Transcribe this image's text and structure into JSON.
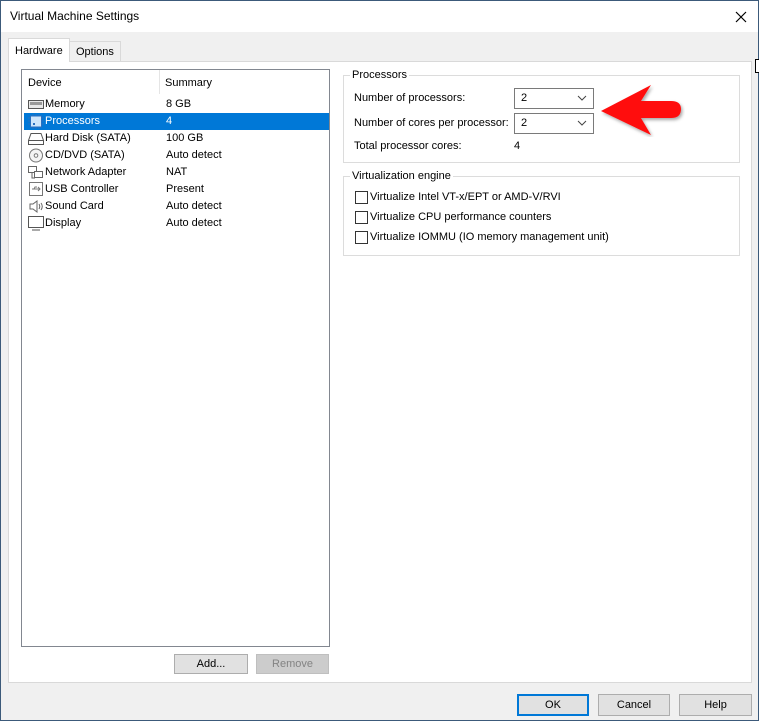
{
  "window": {
    "title": "Virtual Machine Settings",
    "close_icon": "close-icon"
  },
  "tabs": [
    {
      "label": "Hardware",
      "active": true
    },
    {
      "label": "Options",
      "active": false
    }
  ],
  "device_list": {
    "columns": [
      "Device",
      "Summary"
    ],
    "rows": [
      {
        "name": "Memory",
        "summary": "8 GB",
        "icon": "memory-icon",
        "selected": false
      },
      {
        "name": "Processors",
        "summary": "4",
        "icon": "processor-icon",
        "selected": true
      },
      {
        "name": "Hard Disk (SATA)",
        "summary": "100 GB",
        "icon": "hard-disk-icon",
        "selected": false
      },
      {
        "name": "CD/DVD (SATA)",
        "summary": "Auto detect",
        "icon": "cd-dvd-icon",
        "selected": false
      },
      {
        "name": "Network Adapter",
        "summary": "NAT",
        "icon": "network-adapter-icon",
        "selected": false
      },
      {
        "name": "USB Controller",
        "summary": "Present",
        "icon": "usb-icon",
        "selected": false
      },
      {
        "name": "Sound Card",
        "summary": "Auto detect",
        "icon": "speaker-icon",
        "selected": false
      },
      {
        "name": "Display",
        "summary": "Auto detect",
        "icon": "monitor-icon",
        "selected": false
      }
    ],
    "add_label": "Add...",
    "remove_label": "Remove"
  },
  "processors": {
    "group_label": "Processors",
    "num_processors_label": "Number of processors:",
    "num_processors_value": "2",
    "cores_per_processor_label": "Number of cores per processor:",
    "cores_per_processor_value": "2",
    "total_cores_label": "Total processor cores:",
    "total_cores_value": "4"
  },
  "virtualization": {
    "group_label": "Virtualization engine",
    "options": [
      {
        "label": "Virtualize Intel VT-x/EPT or AMD-V/RVI",
        "checked": false
      },
      {
        "label": "Virtualize CPU performance counters",
        "checked": false
      },
      {
        "label": "Virtualize IOMMU (IO memory management unit)",
        "checked": false
      }
    ]
  },
  "footer": {
    "ok_label": "OK",
    "cancel_label": "Cancel",
    "help_label": "Help"
  },
  "annotation": {
    "arrow_color": "#ff0000",
    "selection_color": "#0078d7"
  }
}
